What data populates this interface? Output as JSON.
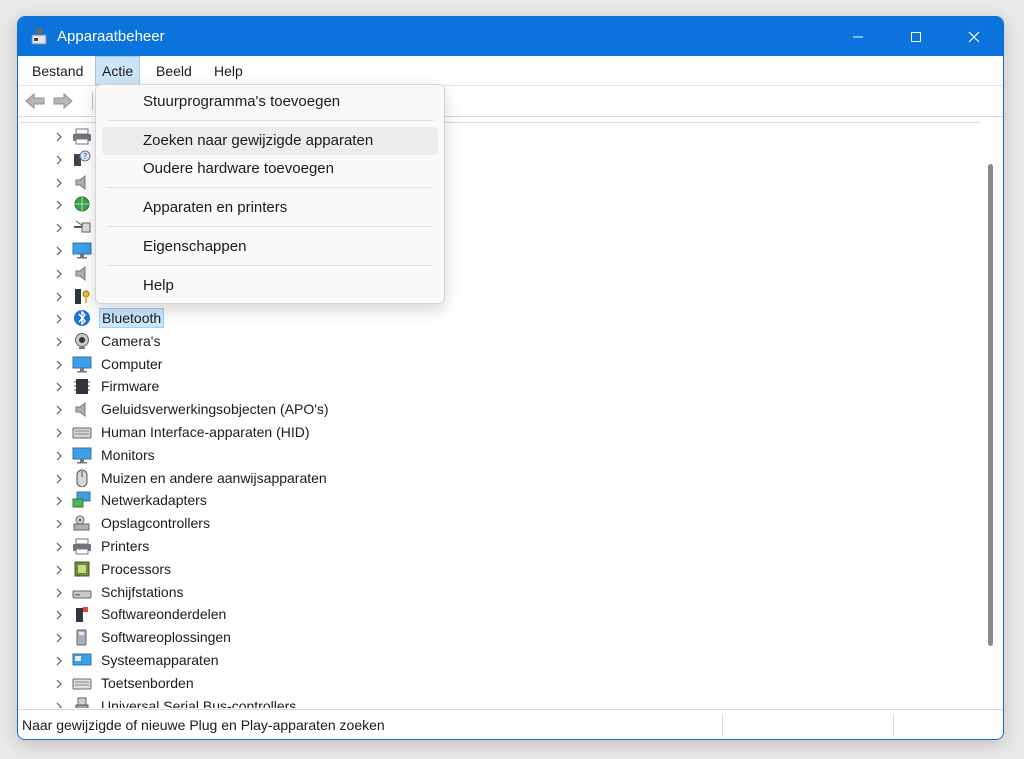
{
  "window": {
    "title": "Apparaatbeheer",
    "app_icon": "device-manager-icon",
    "accent_color": "#0a74dc"
  },
  "menubar": {
    "items": [
      {
        "label": "Bestand"
      },
      {
        "label": "Actie",
        "active": true
      },
      {
        "label": "Beeld"
      },
      {
        "label": "Help"
      }
    ]
  },
  "toolbar": {
    "back_icon": "arrow-left-icon",
    "forward_icon": "arrow-right-icon"
  },
  "action_menu": {
    "items": [
      {
        "label": "Stuurprogramma's toevoegen"
      },
      {
        "label": "Zoeken naar gewijzigde apparaten",
        "hovered": true
      },
      {
        "label": "Oudere hardware toevoegen"
      },
      {
        "label": "Apparaten en printers"
      },
      {
        "label": "Eigenschappen"
      },
      {
        "label": "Help"
      }
    ]
  },
  "tree": {
    "hidden_rows": [
      {
        "icon": "printer-icon"
      },
      {
        "icon": "question-device-icon"
      },
      {
        "icon": "speaker-icon"
      },
      {
        "icon": "network-globe-icon"
      },
      {
        "icon": "ports-connector-icon"
      },
      {
        "icon": "monitor-icon"
      },
      {
        "icon": "speaker-icon"
      },
      {
        "icon": "security-key-icon"
      }
    ],
    "categories": [
      {
        "label": "Bluetooth",
        "icon": "bluetooth-icon",
        "selected": true
      },
      {
        "label": "Camera's",
        "icon": "webcam-icon"
      },
      {
        "label": "Computer",
        "icon": "computer-icon"
      },
      {
        "label": "Firmware",
        "icon": "firmware-chip-icon"
      },
      {
        "label": "Geluidsverwerkingsobjecten (APO's)",
        "icon": "speaker-icon"
      },
      {
        "label": "Human Interface-apparaten (HID)",
        "icon": "hid-keyboard-icon"
      },
      {
        "label": "Monitors",
        "icon": "monitor-icon"
      },
      {
        "label": "Muizen en andere aanwijsapparaten",
        "icon": "mouse-icon"
      },
      {
        "label": "Netwerkadapters",
        "icon": "network-adapter-icon"
      },
      {
        "label": "Opslagcontrollers",
        "icon": "storage-controller-icon"
      },
      {
        "label": "Printers",
        "icon": "printer-icon"
      },
      {
        "label": "Processors",
        "icon": "cpu-icon"
      },
      {
        "label": "Schijfstations",
        "icon": "disk-drive-icon"
      },
      {
        "label": "Softwareonderdelen",
        "icon": "software-component-icon"
      },
      {
        "label": "Softwareoplossingen",
        "icon": "software-device-icon"
      },
      {
        "label": "Systeemapparaten",
        "icon": "system-device-icon"
      },
      {
        "label": "Toetsenborden",
        "icon": "keyboard-icon"
      },
      {
        "label": "Universal Serial Bus-controllers",
        "icon": "usb-icon"
      }
    ]
  },
  "statusbar": {
    "text": "Naar gewijzigde of nieuwe Plug en Play-apparaten zoeken"
  }
}
